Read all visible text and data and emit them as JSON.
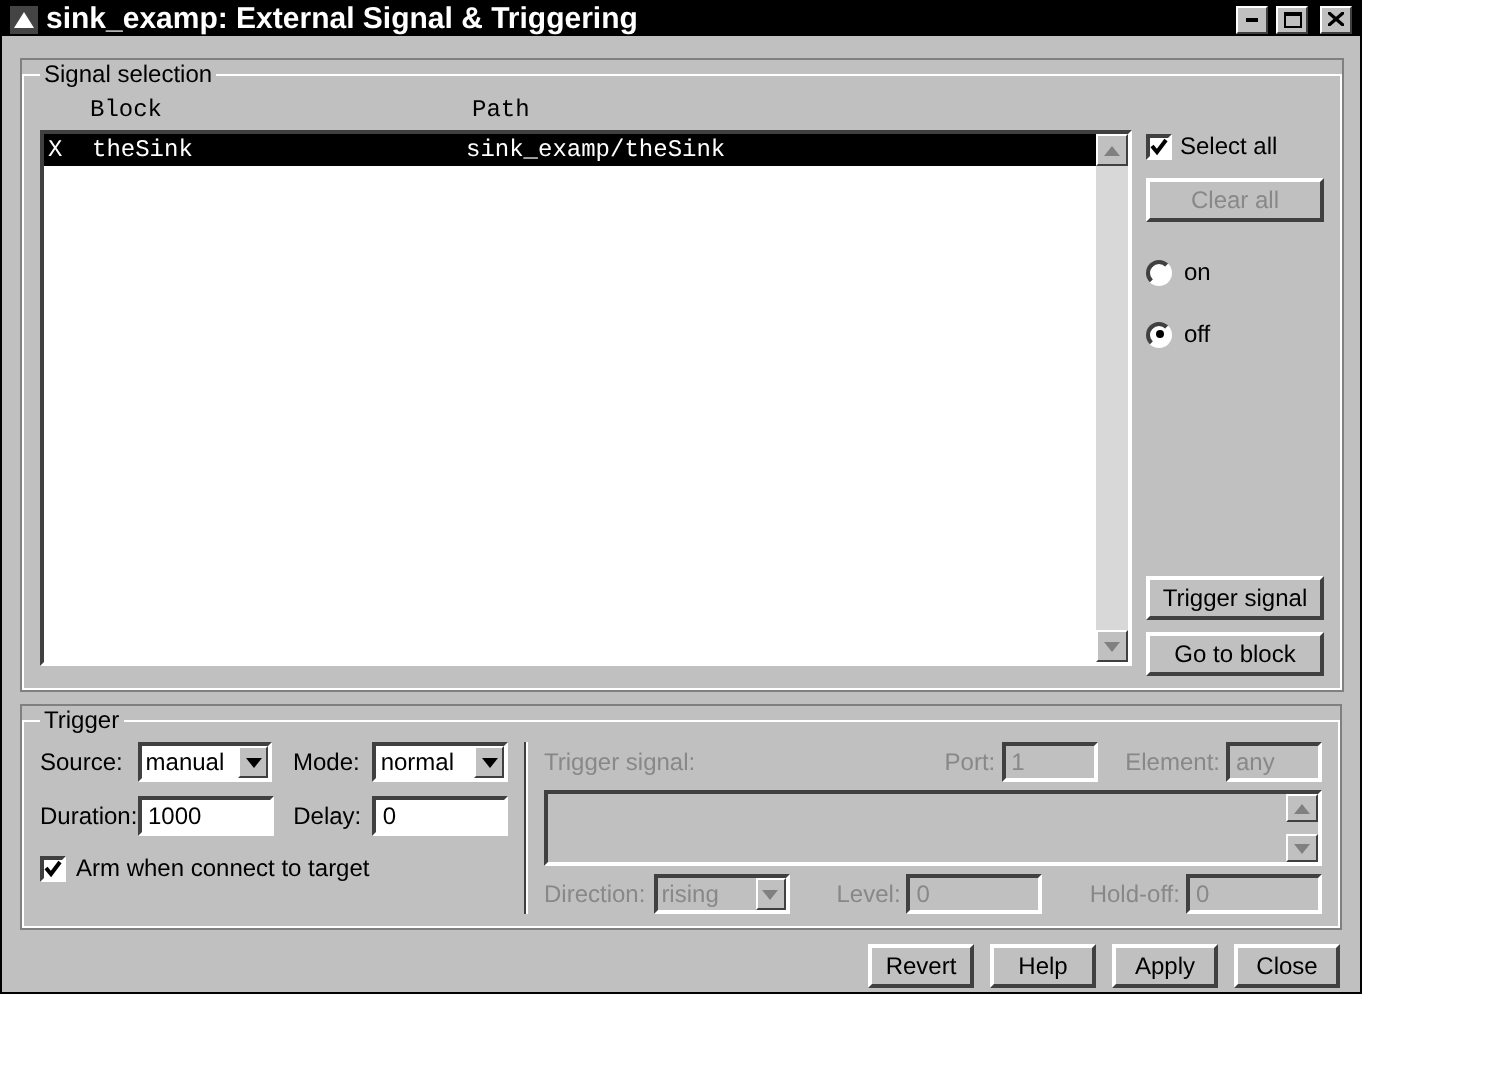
{
  "window": {
    "title": "sink_examp: External Signal & Triggering"
  },
  "signal_selection": {
    "title": "Signal selection",
    "columns": [
      "Block",
      "Path"
    ],
    "rows": [
      {
        "mark": "X",
        "block": "theSink",
        "path": "sink_examp/theSink",
        "selected": true
      }
    ],
    "select_all": {
      "label": "Select all",
      "checked": true
    },
    "clear_all": {
      "label": "Clear all",
      "disabled": true
    },
    "radios": [
      {
        "label": "on",
        "selected": false
      },
      {
        "label": "off",
        "selected": true
      }
    ],
    "buttons": [
      "Trigger signal",
      "Go to block"
    ]
  },
  "trigger": {
    "title": "Trigger",
    "source": {
      "label": "Source:",
      "value": "manual"
    },
    "mode": {
      "label": "Mode:",
      "value": "normal"
    },
    "duration": {
      "label": "Duration:",
      "value": "1000"
    },
    "delay": {
      "label": "Delay:",
      "value": "0"
    },
    "arm": {
      "label": "Arm when connect to target",
      "checked": true
    },
    "signal_panel": {
      "disabled": true,
      "trigger_signal": "Trigger signal:",
      "port": {
        "label": "Port:",
        "value": "1"
      },
      "element": {
        "label": "Element:",
        "value": "any"
      },
      "direction": {
        "label": "Direction:",
        "value": "rising"
      },
      "level": {
        "label": "Level:",
        "value": "0"
      },
      "hold_off": {
        "label": "Hold-off:",
        "value": "0"
      }
    }
  },
  "buttons": [
    "Revert",
    "Help",
    "Apply",
    "Close"
  ]
}
